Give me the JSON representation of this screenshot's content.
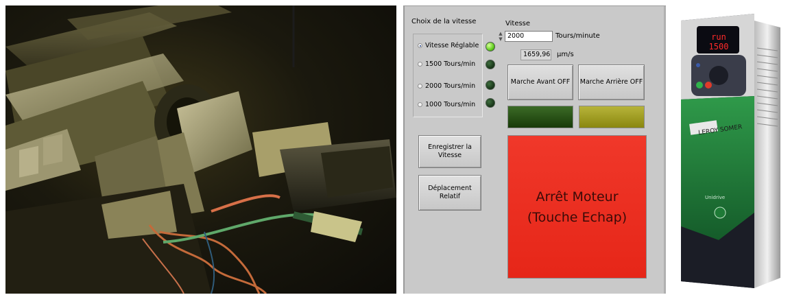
{
  "panel": {
    "speed_choice_title": "Choix de la vitesse",
    "options": [
      {
        "label": "Vitesse Réglable",
        "selected": true,
        "led_on": true
      },
      {
        "label": "1500 Tours/min",
        "selected": false,
        "led_on": false
      },
      {
        "label": "2000 Tours/min",
        "selected": false,
        "led_on": false
      },
      {
        "label": "1000 Tours/min",
        "selected": false,
        "led_on": false
      }
    ],
    "speed_label": "Vitesse",
    "speed_value": "2000",
    "speed_unit": "Tours/minute",
    "linear_speed_value": "1659,96",
    "linear_speed_unit": "µm/s",
    "forward_button": "Marche Avant OFF",
    "backward_button": "Marche Arrière OFF",
    "forward_led_color": "#1f4a0e",
    "backward_led_color": "#9c9a14",
    "save_speed_button_line1": "Enregistrer la",
    "save_speed_button_line2": "Vitesse",
    "relative_move_button_line1": "Déplacement",
    "relative_move_button_line2": "Relatif",
    "stop_button_line1": "Arrêt Moteur",
    "stop_button_line2": "(Touche Echap)",
    "stop_color": "#ea2a1c"
  },
  "drive": {
    "display_line1": "run",
    "display_line2": "1500",
    "brand": "LEROY SOMER",
    "model": "Unidrive"
  }
}
